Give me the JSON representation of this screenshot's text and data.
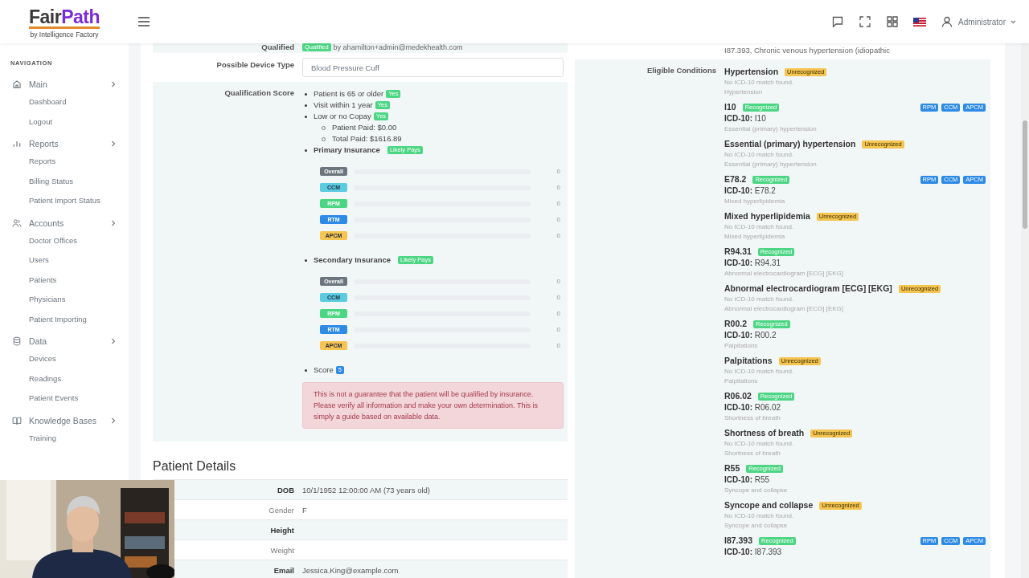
{
  "header": {
    "logo": {
      "first": "Fair",
      "second": "Path",
      "tagline": "by Intelligence Factory"
    },
    "user": "Administrator"
  },
  "sidebar": {
    "heading": "NAVIGATION",
    "sections": [
      {
        "label": "Main",
        "items": [
          "Dashboard",
          "Logout"
        ]
      },
      {
        "label": "Reports",
        "items": [
          "Reports",
          "Billing Status",
          "Patient Import Status"
        ]
      },
      {
        "label": "Accounts",
        "items": [
          "Doctor Offices",
          "Users",
          "Patients",
          "Physicians",
          "Patient Importing"
        ]
      },
      {
        "label": "Data",
        "items": [
          "Devices",
          "Readings",
          "Patient Events"
        ]
      },
      {
        "label": "Knowledge Bases",
        "items": [
          "Training"
        ]
      }
    ]
  },
  "qualified": {
    "label": "Qualified",
    "badge": "Qualified",
    "by": "by ahamilton+admin@medekhealth.com"
  },
  "device_type": {
    "label": "Possible Device Type",
    "value": "Blood Pressure Cuff"
  },
  "qualification_score": {
    "label": "Qualification Score",
    "criteria": [
      {
        "text": "Patient is 65 or older",
        "badge": "Yes"
      },
      {
        "text": "Visit within 1 year",
        "badge": "Yes"
      },
      {
        "text": "Low or no Copay",
        "badge": "Yes",
        "children": [
          "Patient Paid: $0.00",
          "Total Paid: $1616.89"
        ]
      }
    ],
    "insurance": [
      {
        "title": "Primary Insurance",
        "badge": "Likely Pays",
        "bars": [
          {
            "label": "Overall",
            "color": "#6c757d",
            "level": 0,
            "reading": "0"
          },
          {
            "label": "CCM",
            "color": "#5bcbe0",
            "level": 0,
            "reading": "0"
          },
          {
            "label": "RPM",
            "color": "#4cd683",
            "level": 0,
            "reading": "0"
          },
          {
            "label": "RTM",
            "color": "#2d8ae5",
            "level": 0,
            "reading": "0"
          },
          {
            "label": "APCM",
            "color": "#f5c451",
            "level": 0,
            "reading": "0"
          }
        ]
      },
      {
        "title": "Secondary Insurance",
        "badge": "Likely Pays",
        "bars": [
          {
            "label": "Overall",
            "color": "#6c757d",
            "level": 0,
            "reading": "0"
          },
          {
            "label": "CCM",
            "color": "#5bcbe0",
            "level": 0,
            "reading": "0"
          },
          {
            "label": "RPM",
            "color": "#4cd683",
            "level": 0,
            "reading": "0"
          },
          {
            "label": "RTM",
            "color": "#2d8ae5",
            "level": 0,
            "reading": "0"
          },
          {
            "label": "APCM",
            "color": "#f5c451",
            "level": 0,
            "reading": "0"
          }
        ]
      }
    ],
    "score": {
      "label": "Score",
      "value": "5"
    },
    "disclaimer": "This is not a guarantee that the patient will be qualified by insurance. Please verify all information and make your own determination. This is simply a guide based on available data."
  },
  "patient_details": {
    "title": "Patient Details",
    "rows": [
      {
        "label": "DOB",
        "value": "10/1/1952 12:00:00 AM (73 years old)"
      },
      {
        "label": "Gender",
        "value": "F"
      },
      {
        "label": "Height"
      },
      {
        "label": "Weight"
      },
      {
        "label": "Email",
        "value": "Jessica.King@example.com"
      }
    ]
  },
  "previous_conditions_tail": "I87.393, Chronic venous hypertension (idiopathic",
  "eligible_conditions": {
    "label": "Eligible Conditions",
    "conditions": [
      {
        "kind": "unrecognized",
        "name": "Hypertension",
        "badge": "Unrecognized",
        "note": "No ICD-10 match found.",
        "description": "Hypertension"
      },
      {
        "kind": "recognized",
        "name": "I10",
        "badge": "Recognized",
        "icd_label": "ICD-10:",
        "icd": "I10",
        "description": "Essential (primary) hypertension",
        "programs": [
          "RPM",
          "CCM",
          "APCM"
        ]
      },
      {
        "kind": "unrecognized",
        "name": "Essential (primary) hypertension",
        "badge": "Unrecognized",
        "note": "No ICD-10 match found.",
        "description": "Essential (primary) hypertension"
      },
      {
        "kind": "recognized",
        "name": "E78.2",
        "badge": "Recognized",
        "icd_label": "ICD-10:",
        "icd": "E78.2",
        "description": "Mixed hyperlipidemia",
        "programs": [
          "RPM",
          "CCM",
          "APCM"
        ]
      },
      {
        "kind": "unrecognized",
        "name": "Mixed hyperlipidemia",
        "badge": "Unrecognized",
        "note": "No ICD-10 match found.",
        "description": "Mixed hyperlipidemia"
      },
      {
        "kind": "recognized",
        "name": "R94.31",
        "badge": "Recognized",
        "icd_label": "ICD-10:",
        "icd": "R94.31",
        "description": "Abnormal electrocardiogram [ECG] [EKG]"
      },
      {
        "kind": "unrecognized",
        "name": "Abnormal electrocardiogram [ECG] [EKG]",
        "badge": "Unrecognized",
        "note": "No ICD-10 match found.",
        "description": "Abnormal electrocardiogram [ECG] [EKG]"
      },
      {
        "kind": "recognized",
        "name": "R00.2",
        "badge": "Recognized",
        "icd_label": "ICD-10:",
        "icd": "R00.2",
        "description": "Palpitations"
      },
      {
        "kind": "unrecognized",
        "name": "Palpitations",
        "badge": "Unrecognized",
        "note": "No ICD-10 match found.",
        "description": "Palpitations"
      },
      {
        "kind": "recognized",
        "name": "R06.02",
        "badge": "Recognized",
        "icd_label": "ICD-10:",
        "icd": "R06.02",
        "description": "Shortness of breath"
      },
      {
        "kind": "unrecognized",
        "name": "Shortness of breath",
        "badge": "Unrecognized",
        "note": "No ICD-10 match found.",
        "description": "Shortness of breath"
      },
      {
        "kind": "recognized",
        "name": "R55",
        "badge": "Recognized",
        "icd_label": "ICD-10:",
        "icd": "R55",
        "description": "Syncope and collapse"
      },
      {
        "kind": "unrecognized",
        "name": "Syncope and collapse",
        "badge": "Unrecognized",
        "note": "No ICD-10 match found.",
        "description": "Syncope and collapse"
      },
      {
        "kind": "recognized",
        "name": "I87.393",
        "badge": "Recognized",
        "icd_label": "ICD-10:",
        "icd": "I87.393",
        "programs": [
          "RPM",
          "CCM",
          "APCM"
        ]
      }
    ]
  }
}
